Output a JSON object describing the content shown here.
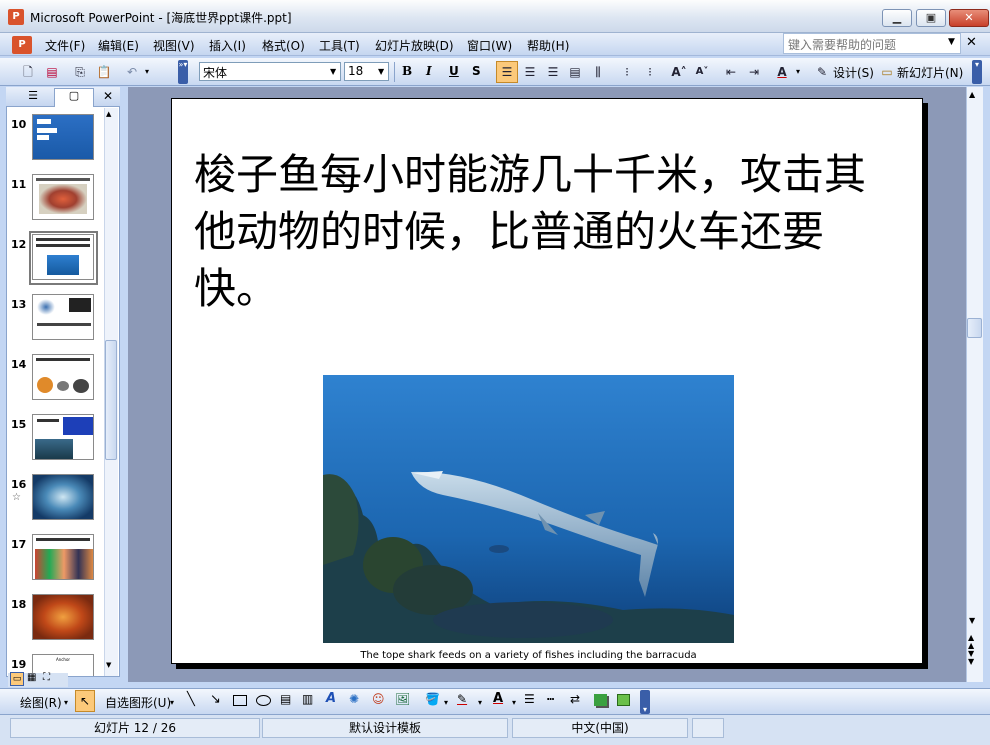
{
  "window": {
    "title": "Microsoft PowerPoint - [海底世界ppt课件.ppt]",
    "minimize_icon": "minimize-icon",
    "maximize_icon": "restore-icon",
    "close_icon": "close-icon"
  },
  "menubar": {
    "items": [
      "文件(F)",
      "编辑(E)",
      "视图(V)",
      "插入(I)",
      "格式(O)",
      "工具(T)",
      "幻灯片放映(D)",
      "窗口(W)",
      "帮助(H)"
    ],
    "help_placeholder": "键入需要帮助的问题"
  },
  "toolbar": {
    "font_name": "宋体",
    "font_size": "18",
    "bold": "B",
    "italic": "I",
    "underline": "U",
    "shadow": "S",
    "design_label": "设计(S)",
    "new_slide_label": "新幻灯片(N)"
  },
  "slides_panel": {
    "thumbnails": [
      {
        "number": "10"
      },
      {
        "number": "11"
      },
      {
        "number": "12"
      },
      {
        "number": "13"
      },
      {
        "number": "14"
      },
      {
        "number": "15"
      },
      {
        "number": "16"
      },
      {
        "number": "17"
      },
      {
        "number": "18"
      },
      {
        "number": "19"
      }
    ],
    "selected": "12",
    "thumb19_text": "Anchor"
  },
  "slide": {
    "body_text": "梭子鱼每小时能游几十千米，攻击其他动物的时候，比普通的火车还要快。",
    "photo_caption": "The tope shark feeds on a variety of fishes including the barracuda"
  },
  "drawbar": {
    "draw_label": "绘图(R)",
    "autoshape_label": "自选图形(U)"
  },
  "statusbar": {
    "slide_position": "幻灯片 12 / 26",
    "design_template": "默认设计模板",
    "language": "中文(中国)"
  },
  "colors": {
    "workspace": "#8c99b7",
    "toolbar_blue": "#c5d6f0",
    "selected_thumb_border": "#7a7a7a"
  }
}
